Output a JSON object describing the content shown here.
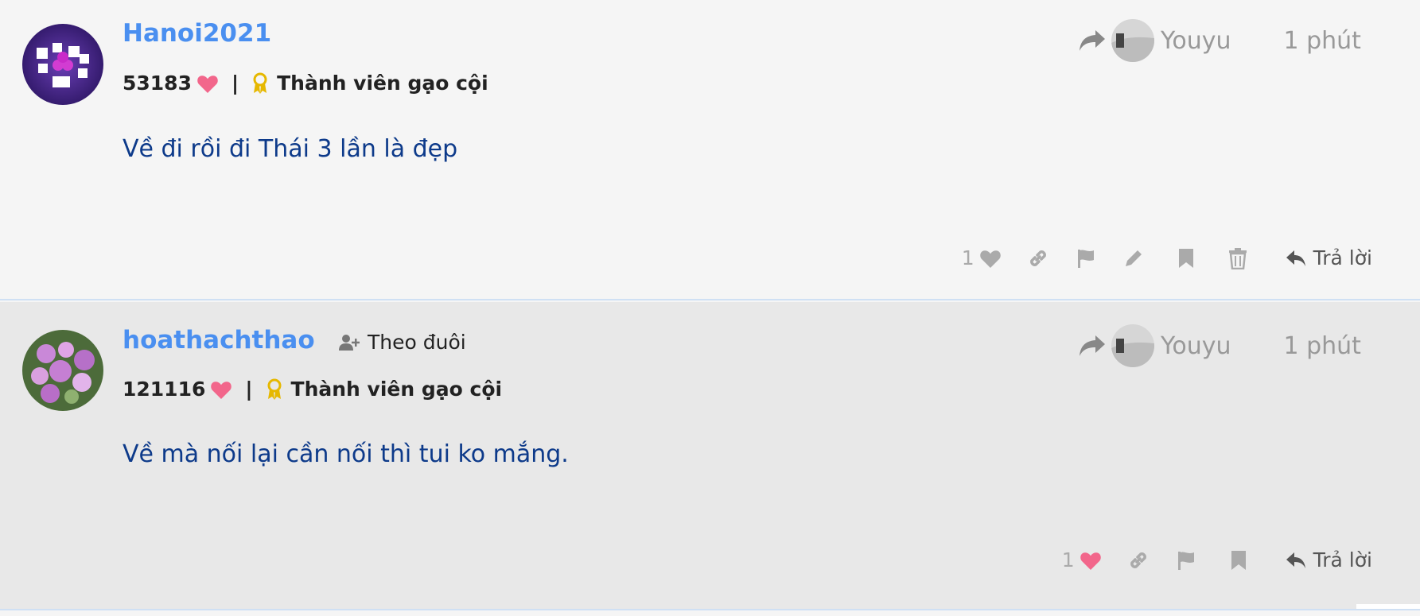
{
  "posts": [
    {
      "username": "Hanoi2021",
      "points": "53183",
      "rank": "Thành viên gạo cội",
      "text": "Về đi rồi đi Thái 3 lần là đẹp",
      "shared_to": "Youyu",
      "time": "1 phút",
      "like_count": "1",
      "reply_label": "Trả lời"
    },
    {
      "username": "hoathachthao",
      "follow_label": "Theo đuôi",
      "points": "121116",
      "rank": "Thành viên gạo cội",
      "text": "Về mà nối lại cần nối thì tui ko mắng.",
      "shared_to": "Youyu",
      "time": "1 phút",
      "like_count": "1",
      "reply_label": "Trả lời"
    }
  ],
  "colors": {
    "username": "#4a8ff0",
    "content": "#0d3a8a",
    "heart": "#f2668b",
    "badge": "#e6b800"
  }
}
